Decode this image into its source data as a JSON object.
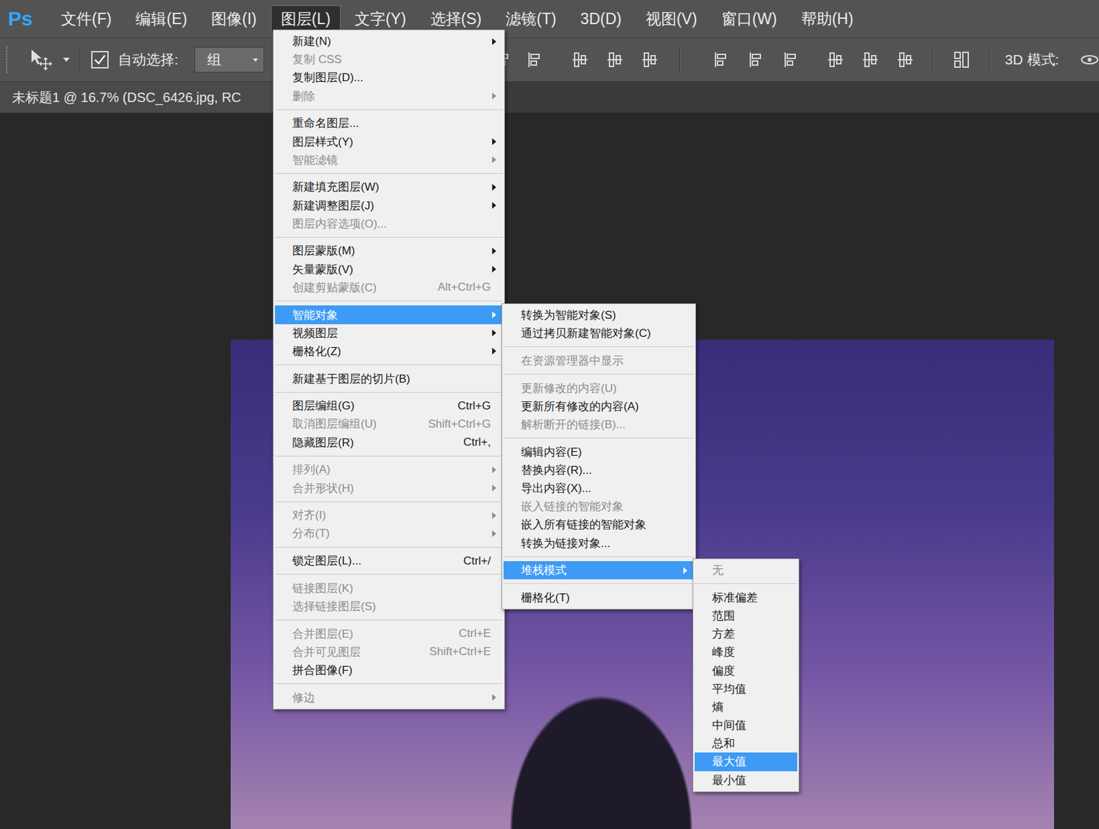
{
  "app": {
    "logo": "Ps"
  },
  "menubar": [
    {
      "label": "文件(F)",
      "selected": false
    },
    {
      "label": "编辑(E)",
      "selected": false
    },
    {
      "label": "图像(I)",
      "selected": false
    },
    {
      "label": "图层(L)",
      "selected": true
    },
    {
      "label": "文字(Y)",
      "selected": false
    },
    {
      "label": "选择(S)",
      "selected": false
    },
    {
      "label": "滤镜(T)",
      "selected": false
    },
    {
      "label": "3D(D)",
      "selected": false
    },
    {
      "label": "视图(V)",
      "selected": false
    },
    {
      "label": "窗口(W)",
      "selected": false
    },
    {
      "label": "帮助(H)",
      "selected": false
    }
  ],
  "options_bar": {
    "auto_select": {
      "label": "自动选择:",
      "checked": true
    },
    "dropdown": {
      "value": "组"
    },
    "mode_label": "3D 模式:"
  },
  "document_tab": {
    "title": "未标题1 @ 16.7% (DSC_6426.jpg, RC"
  },
  "layer_menu": {
    "groups": [
      [
        {
          "label": "新建(N)",
          "submenu": true,
          "disabled": false,
          "selected": false
        },
        {
          "label": "复制 CSS",
          "submenu": false,
          "disabled": true,
          "selected": false
        },
        {
          "label": "复制图层(D)...",
          "submenu": false,
          "disabled": false,
          "selected": false
        },
        {
          "label": "删除",
          "submenu": true,
          "disabled": true,
          "selected": false
        }
      ],
      [
        {
          "label": "重命名图层...",
          "submenu": false,
          "disabled": false,
          "selected": false
        },
        {
          "label": "图层样式(Y)",
          "submenu": true,
          "disabled": false,
          "selected": false
        },
        {
          "label": "智能滤镜",
          "submenu": true,
          "disabled": true,
          "selected": false
        }
      ],
      [
        {
          "label": "新建填充图层(W)",
          "submenu": true,
          "disabled": false,
          "selected": false
        },
        {
          "label": "新建调整图层(J)",
          "submenu": true,
          "disabled": false,
          "selected": false
        },
        {
          "label": "图层内容选项(O)...",
          "submenu": false,
          "disabled": true,
          "selected": false
        }
      ],
      [
        {
          "label": "图层蒙版(M)",
          "submenu": true,
          "disabled": false,
          "selected": false
        },
        {
          "label": "矢量蒙版(V)",
          "submenu": true,
          "disabled": false,
          "selected": false
        },
        {
          "label": "创建剪贴蒙版(C)",
          "shortcut": "Alt+Ctrl+G",
          "submenu": false,
          "disabled": true,
          "selected": false
        }
      ],
      [
        {
          "label": "智能对象",
          "submenu": true,
          "disabled": false,
          "selected": true
        },
        {
          "label": "视频图层",
          "submenu": true,
          "disabled": false,
          "selected": false
        },
        {
          "label": "栅格化(Z)",
          "submenu": true,
          "disabled": false,
          "selected": false
        }
      ],
      [
        {
          "label": "新建基于图层的切片(B)",
          "submenu": false,
          "disabled": false,
          "selected": false
        }
      ],
      [
        {
          "label": "图层编组(G)",
          "shortcut": "Ctrl+G",
          "submenu": false,
          "disabled": false,
          "selected": false
        },
        {
          "label": "取消图层编组(U)",
          "shortcut": "Shift+Ctrl+G",
          "submenu": false,
          "disabled": true,
          "selected": false
        },
        {
          "label": "隐藏图层(R)",
          "shortcut": "Ctrl+,",
          "submenu": false,
          "disabled": false,
          "selected": false
        }
      ],
      [
        {
          "label": "排列(A)",
          "submenu": true,
          "disabled": true,
          "selected": false
        },
        {
          "label": "合并形状(H)",
          "submenu": true,
          "disabled": true,
          "selected": false
        }
      ],
      [
        {
          "label": "对齐(I)",
          "submenu": true,
          "disabled": true,
          "selected": false
        },
        {
          "label": "分布(T)",
          "submenu": true,
          "disabled": true,
          "selected": false
        }
      ],
      [
        {
          "label": "锁定图层(L)...",
          "shortcut": "Ctrl+/",
          "submenu": false,
          "disabled": false,
          "selected": false
        }
      ],
      [
        {
          "label": "链接图层(K)",
          "submenu": false,
          "disabled": true,
          "selected": false
        },
        {
          "label": "选择链接图层(S)",
          "submenu": false,
          "disabled": true,
          "selected": false
        }
      ],
      [
        {
          "label": "合并图层(E)",
          "shortcut": "Ctrl+E",
          "submenu": false,
          "disabled": true,
          "selected": false
        },
        {
          "label": "合并可见图层",
          "shortcut": "Shift+Ctrl+E",
          "submenu": false,
          "disabled": true,
          "selected": false
        },
        {
          "label": "拼合图像(F)",
          "submenu": false,
          "disabled": false,
          "selected": false
        }
      ],
      [
        {
          "label": "修边",
          "submenu": true,
          "disabled": true,
          "selected": false
        }
      ]
    ]
  },
  "smart_object_menu": {
    "groups": [
      [
        {
          "label": "转换为智能对象(S)",
          "submenu": false,
          "disabled": false,
          "selected": false
        },
        {
          "label": "通过拷贝新建智能对象(C)",
          "submenu": false,
          "disabled": false,
          "selected": false
        }
      ],
      [
        {
          "label": "在资源管理器中显示",
          "submenu": false,
          "disabled": true,
          "selected": false
        }
      ],
      [
        {
          "label": "更新修改的内容(U)",
          "submenu": false,
          "disabled": true,
          "selected": false
        },
        {
          "label": "更新所有修改的内容(A)",
          "submenu": false,
          "disabled": false,
          "selected": false
        },
        {
          "label": "解析断开的链接(B)...",
          "submenu": false,
          "disabled": true,
          "selected": false
        }
      ],
      [
        {
          "label": "编辑内容(E)",
          "submenu": false,
          "disabled": false,
          "selected": false
        },
        {
          "label": "替换内容(R)...",
          "submenu": false,
          "disabled": false,
          "selected": false
        },
        {
          "label": "导出内容(X)...",
          "submenu": false,
          "disabled": false,
          "selected": false
        },
        {
          "label": "嵌入链接的智能对象",
          "submenu": false,
          "disabled": true,
          "selected": false
        },
        {
          "label": "嵌入所有链接的智能对象",
          "submenu": false,
          "disabled": false,
          "selected": false
        },
        {
          "label": "转换为链接对象...",
          "submenu": false,
          "disabled": false,
          "selected": false
        }
      ],
      [
        {
          "label": "堆栈模式",
          "submenu": true,
          "disabled": false,
          "selected": true
        }
      ],
      [
        {
          "label": "栅格化(T)",
          "submenu": false,
          "disabled": false,
          "selected": false
        }
      ]
    ]
  },
  "stack_mode_menu": {
    "groups": [
      [
        {
          "label": "无",
          "submenu": false,
          "disabled": true,
          "selected": false
        }
      ],
      [
        {
          "label": "标准偏差",
          "submenu": false,
          "disabled": false,
          "selected": false
        },
        {
          "label": "范围",
          "submenu": false,
          "disabled": false,
          "selected": false
        },
        {
          "label": "方差",
          "submenu": false,
          "disabled": false,
          "selected": false
        },
        {
          "label": "峰度",
          "submenu": false,
          "disabled": false,
          "selected": false
        },
        {
          "label": "偏度",
          "submenu": false,
          "disabled": false,
          "selected": false
        },
        {
          "label": "平均值",
          "submenu": false,
          "disabled": false,
          "selected": false
        },
        {
          "label": "熵",
          "submenu": false,
          "disabled": false,
          "selected": false
        },
        {
          "label": "中间值",
          "submenu": false,
          "disabled": false,
          "selected": false
        },
        {
          "label": "总和",
          "submenu": false,
          "disabled": false,
          "selected": false
        },
        {
          "label": "最大值",
          "submenu": false,
          "disabled": false,
          "selected": true
        },
        {
          "label": "最小值",
          "submenu": false,
          "disabled": false,
          "selected": false
        }
      ]
    ]
  }
}
